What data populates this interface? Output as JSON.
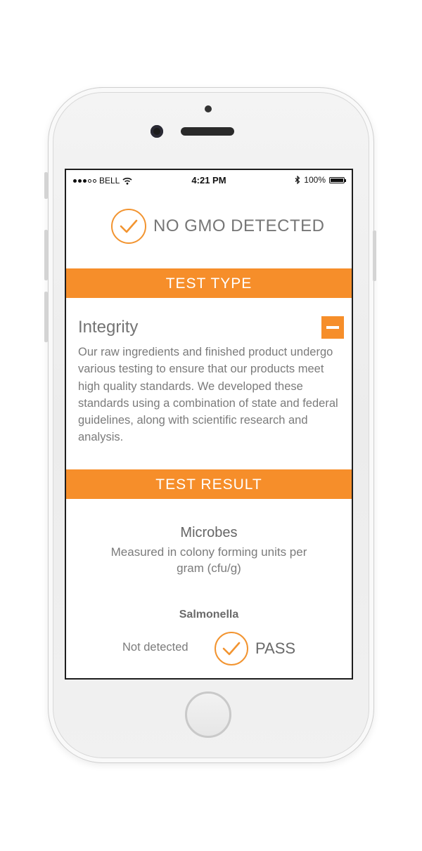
{
  "status_bar": {
    "carrier": "BELL",
    "time": "4:21 PM",
    "battery": "100%",
    "icons": [
      "signal-dots",
      "wifi-icon",
      "bluetooth-icon",
      "battery-icon"
    ]
  },
  "header": {
    "status_text": "NO GMO DETECTED",
    "icon": "checkmark-circle-icon"
  },
  "test_type": {
    "band_label": "TEST TYPE",
    "title": "Integrity",
    "collapse_icon": "minus-icon",
    "description": "Our raw ingredients and finished product undergo various testing to ensure that our products meet high quality standards. We developed these standards using a combination of state and federal guidelines, along with scientific research and analysis."
  },
  "test_result": {
    "band_label": "TEST RESULT",
    "category_title": "Microbes",
    "category_subtitle": "Measured in colony forming units per gram (cfu/g)",
    "tests": [
      {
        "name": "Salmonella",
        "value": "Not detected",
        "status": "PASS",
        "icon": "checkmark-circle-icon"
      }
    ]
  },
  "colors": {
    "accent": "#f68e2a",
    "text": "#7b7b7b"
  }
}
